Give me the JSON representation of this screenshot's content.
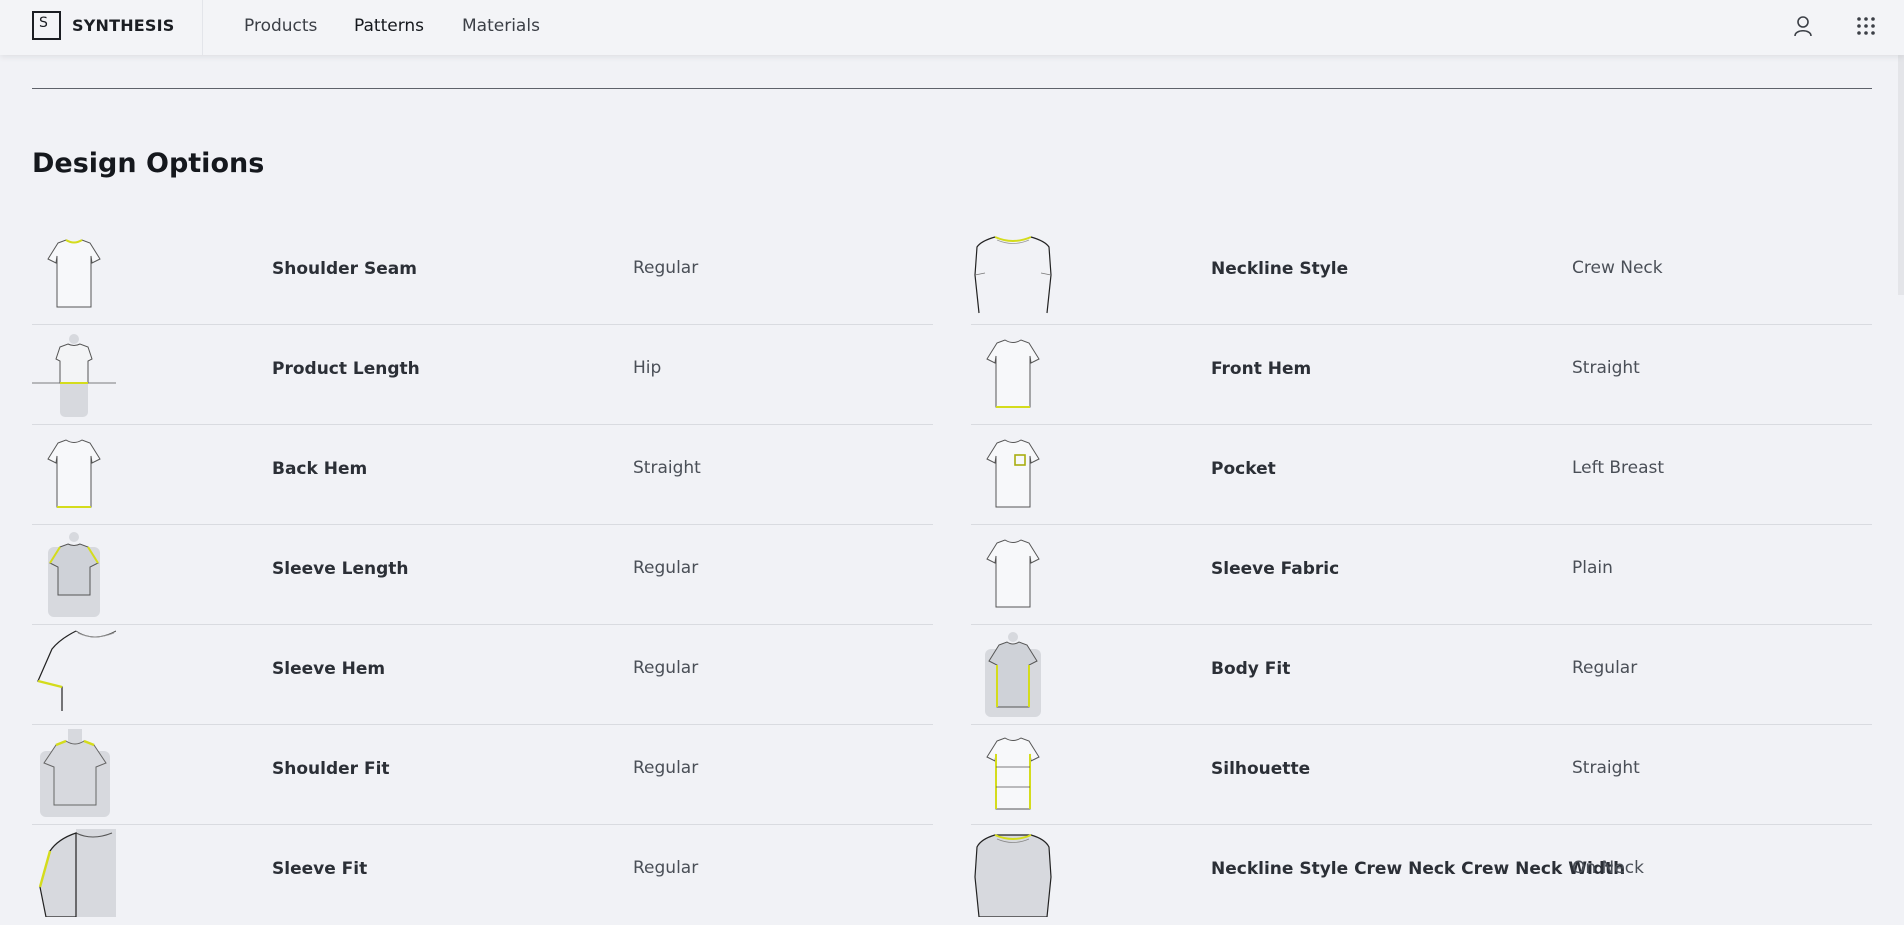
{
  "header": {
    "logo_letter": "S",
    "brand": "SYNTHESIS",
    "nav": [
      "Products",
      "Patterns",
      "Materials"
    ]
  },
  "section": {
    "title": "Design Options"
  },
  "accent_color": "#d4dc1c",
  "options": {
    "left": [
      {
        "label": "Shoulder Seam",
        "value": "Regular",
        "icon": "tshirt-shoulder-seam-icon"
      },
      {
        "label": "Product Length",
        "value": "Hip",
        "icon": "figure-length-icon"
      },
      {
        "label": "Back Hem",
        "value": "Straight",
        "icon": "tshirt-back-hem-icon"
      },
      {
        "label": "Sleeve Length",
        "value": "Regular",
        "icon": "figure-sleeve-length-icon"
      },
      {
        "label": "Sleeve Hem",
        "value": "Regular",
        "icon": "sleeve-hem-icon"
      },
      {
        "label": "Shoulder Fit",
        "value": "Regular",
        "icon": "figure-shoulder-fit-icon"
      },
      {
        "label": "Sleeve Fit",
        "value": "Regular",
        "icon": "sleeve-fit-icon"
      }
    ],
    "right": [
      {
        "label": "Neckline Style",
        "value": "Crew Neck",
        "icon": "neckline-icon"
      },
      {
        "label": "Front Hem",
        "value": "Straight",
        "icon": "tshirt-front-hem-icon"
      },
      {
        "label": "Pocket",
        "value": "Left Breast",
        "icon": "tshirt-pocket-icon"
      },
      {
        "label": "Sleeve Fabric",
        "value": "Plain",
        "icon": "tshirt-sleeve-fabric-icon"
      },
      {
        "label": "Body Fit",
        "value": "Regular",
        "icon": "figure-body-fit-icon"
      },
      {
        "label": "Silhouette",
        "value": "Straight",
        "icon": "tshirt-silhouette-icon"
      },
      {
        "label": "Neckline Style Crew Neck Crew Neck Width",
        "value": "On Neck",
        "icon": "neckline-width-icon"
      }
    ]
  }
}
